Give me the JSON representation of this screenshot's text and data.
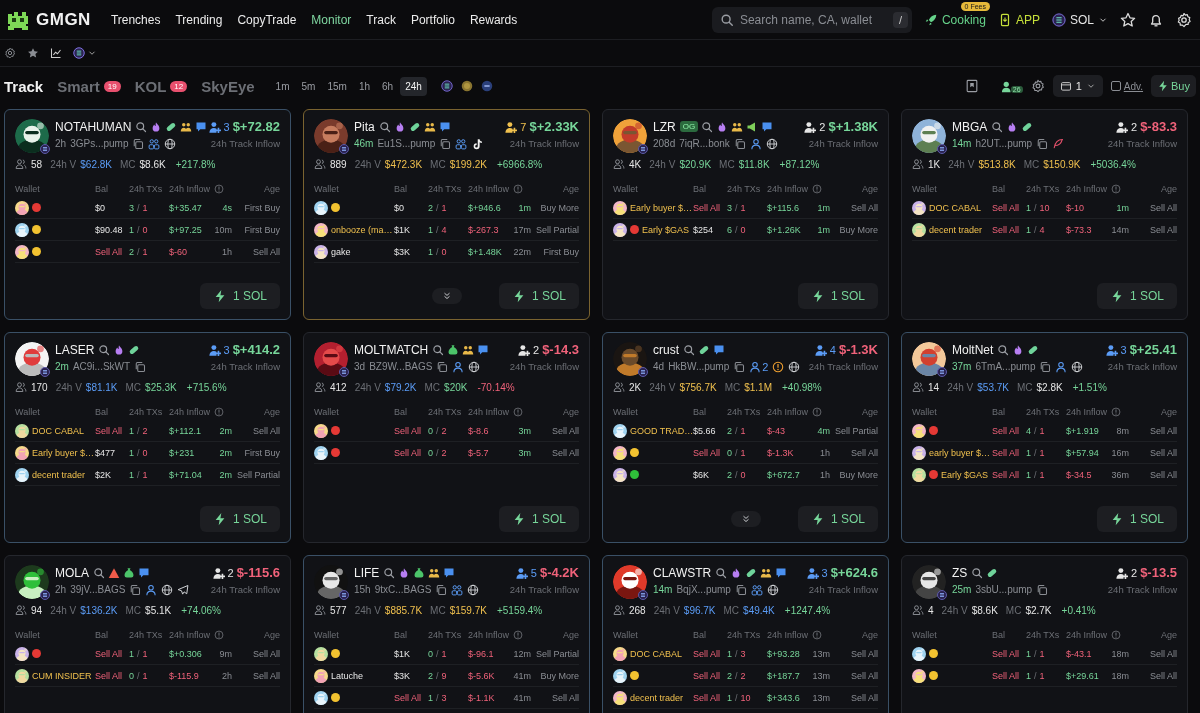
{
  "nav": {
    "logo": "GMGN",
    "items": [
      {
        "label": "Trenches",
        "selected": false
      },
      {
        "label": "Trending",
        "selected": false
      },
      {
        "label": "CopyTrade",
        "selected": false
      },
      {
        "label": "Monitor",
        "selected": true
      },
      {
        "label": "Track",
        "selected": false
      },
      {
        "label": "Portfolio",
        "selected": false
      },
      {
        "label": "Rewards",
        "selected": false
      }
    ],
    "search": {
      "placeholder": "Search name, CA, wallet",
      "shortcut": "/"
    },
    "cooking": {
      "label": "Cooking",
      "badge": "0 Fees"
    },
    "app": "APP",
    "chain": "SOL"
  },
  "tabs": [
    {
      "label": "Track",
      "selected": true
    },
    {
      "label": "Smart",
      "count": "19",
      "selected": false
    },
    {
      "label": "KOL",
      "count": "12",
      "selected": false
    },
    {
      "label": "SkyEye",
      "selected": false
    }
  ],
  "periods": [
    {
      "label": "1m",
      "selected": false
    },
    {
      "label": "5m",
      "selected": false
    },
    {
      "label": "15m",
      "selected": false
    },
    {
      "label": "1h",
      "selected": false
    },
    {
      "label": "6h",
      "selected": false
    },
    {
      "label": "24h",
      "selected": true
    }
  ],
  "toolbar": {
    "count": "26",
    "quantity": "1",
    "adv": {
      "label": "Adv.",
      "checked": false
    },
    "buy": "Buy"
  },
  "cards": [
    {
      "name": "NOTAHUMAN",
      "age": "2h",
      "age_recent": false,
      "address": "3GPs...pump",
      "badges": [
        {
          "kind": "search"
        },
        {
          "kind": "fire"
        },
        {
          "kind": "pill"
        },
        {
          "kind": "group"
        },
        {
          "kind": "chat"
        }
      ],
      "links": [
        {
          "kind": "copy"
        },
        {
          "kind": "group"
        },
        {
          "kind": "web"
        }
      ],
      "tracker": {
        "count": "3",
        "color": "#5b9cf6"
      },
      "inflow": "$+72.82",
      "inflow_up": true,
      "inflow_label": "24h Track Inflow",
      "holders": "58",
      "volume_label": "24h V",
      "volume": {
        "value": "$62.8K",
        "kind": "blue"
      },
      "mc_label": "MC",
      "mc": {
        "value": "$8.6K",
        "kind": "plain"
      },
      "change": "+217.8%",
      "change_up": true,
      "border": {
        "color": "#3a5066"
      },
      "expandable": false,
      "columns": [
        "Wallet",
        "Bal",
        "24h TXs",
        "24h Inflow",
        "Age"
      ],
      "buy": "1 SOL",
      "rows": [
        {
          "color": "#e53935",
          "bal": "$0",
          "sell_all": false,
          "buys": "3",
          "sep": "/",
          "sells": "1",
          "inflow": "$+35.47",
          "inflow_up": true,
          "age": "4s",
          "age_recent": true,
          "action": "First Buy"
        },
        {
          "color": "#f2c230",
          "bal": "$90.48",
          "sell_all": false,
          "buys": "1",
          "sep": "/",
          "sells": "0",
          "inflow": "$+97.25",
          "inflow_up": true,
          "age": "10m",
          "age_recent": false,
          "action": "First Buy"
        },
        {
          "color": "#f2c230",
          "bal": "Sell All",
          "sell_all": true,
          "buys": "2",
          "sep": "/",
          "sells": "1",
          "inflow": "$-60",
          "inflow_up": false,
          "age": "1h",
          "age_recent": false,
          "action": "Sell All"
        }
      ]
    },
    {
      "name": "Pita",
      "age": "46m",
      "age_recent": true,
      "address": "Eu1S...pump",
      "badges": [
        {
          "kind": "search"
        },
        {
          "kind": "fire"
        },
        {
          "kind": "pill"
        },
        {
          "kind": "group"
        },
        {
          "kind": "chat"
        }
      ],
      "links": [
        {
          "kind": "copy"
        },
        {
          "kind": "group"
        },
        {
          "kind": "tiktok"
        }
      ],
      "tracker": {
        "count": "7",
        "color": "#f0c04e"
      },
      "inflow": "$+2.33K",
      "inflow_up": true,
      "inflow_label": "24h Track Inflow",
      "holders": "889",
      "volume_label": "24h V",
      "volume": {
        "value": "$472.3K",
        "kind": "gold"
      },
      "mc_label": "MC",
      "mc": {
        "value": "$199.2K",
        "kind": "gold"
      },
      "change": "+6966.8%",
      "change_up": true,
      "border": {
        "color": "#7a6330"
      },
      "expandable": true,
      "columns": [
        "Wallet",
        "Bal",
        "24h TXs",
        "24h Inflow",
        "Age"
      ],
      "buy": "1 SOL",
      "rows": [
        {
          "color": "#f2c230",
          "bal": "$0",
          "sell_all": false,
          "buys": "2",
          "sep": "/",
          "sells": "1",
          "inflow": "$+946.6",
          "inflow_up": true,
          "age": "1m",
          "age_recent": true,
          "action": "Buy More"
        },
        {
          "wallet": "onbooze (ma…",
          "wallet_highlight": true,
          "bal": "$1K",
          "sell_all": false,
          "buys": "1",
          "sep": "/",
          "sells": "4",
          "inflow": "$-267.3",
          "inflow_up": false,
          "age": "17m",
          "age_recent": false,
          "action": "Sell Partial"
        },
        {
          "wallet": "gake",
          "wallet_highlight": false,
          "bal": "$3K",
          "sell_all": false,
          "buys": "1",
          "sep": "/",
          "sells": "0",
          "inflow": "$+1.48K",
          "inflow_up": true,
          "age": "22m",
          "age_recent": false,
          "action": "First Buy"
        }
      ]
    },
    {
      "name": "LZR",
      "tag": "OG",
      "age": "208d",
      "age_recent": false,
      "address": "7iqR...bonk",
      "badges": [
        {
          "kind": "search"
        },
        {
          "kind": "fire"
        },
        {
          "kind": "group"
        },
        {
          "kind": "megaphone"
        },
        {
          "kind": "chat"
        }
      ],
      "links": [
        {
          "kind": "copy"
        },
        {
          "kind": "person"
        },
        {
          "kind": "web"
        }
      ],
      "tracker": {
        "count": "2",
        "color": "#e6e6e6"
      },
      "inflow": "$+1.38K",
      "inflow_up": true,
      "inflow_label": "24h Track Inflow",
      "holders": "4K",
      "volume_label": "24h V",
      "volume": {
        "value": "$20.9K",
        "kind": "green"
      },
      "mc_label": "MC",
      "mc": {
        "value": "$11.8K",
        "kind": "green"
      },
      "change": "+87.12%",
      "change_up": true,
      "border": {
        "color": "#25272d"
      },
      "expandable": false,
      "columns": [
        "Wallet",
        "Bal",
        "24h TXs",
        "24h Inflow",
        "Age"
      ],
      "buy": "1 SOL",
      "rows": [
        {
          "wallet": "Early buyer $…",
          "wallet_highlight": true,
          "bal": "Sell All",
          "sell_all": true,
          "buys": "3",
          "sep": "/",
          "sells": "1",
          "inflow": "$+115.6",
          "inflow_up": true,
          "age": "1m",
          "age_recent": true,
          "action": "Sell All"
        },
        {
          "color": "#e53935",
          "wallet": "Early $GAS",
          "wallet_highlight": true,
          "bal": "$254",
          "sell_all": false,
          "buys": "6",
          "sep": "/",
          "sells": "0",
          "inflow": "$+1.26K",
          "inflow_up": true,
          "age": "1m",
          "age_recent": true,
          "action": "Buy More"
        }
      ]
    },
    {
      "name": "MBGA",
      "age": "14m",
      "age_recent": true,
      "address": "h2UT...pump",
      "badges": [
        {
          "kind": "search"
        },
        {
          "kind": "fire"
        },
        {
          "kind": "pill"
        }
      ],
      "links": [
        {
          "kind": "copy"
        },
        {
          "kind": "feather"
        }
      ],
      "tracker": {
        "count": "2",
        "color": "#e6e6e6"
      },
      "inflow": "$-83.3",
      "inflow_up": false,
      "inflow_label": "24h Track Inflow",
      "holders": "1K",
      "volume_label": "24h V",
      "volume": {
        "value": "$513.8K",
        "kind": "gold"
      },
      "mc_label": "MC",
      "mc": {
        "value": "$150.9K",
        "kind": "gold"
      },
      "change": "+5036.4%",
      "change_up": true,
      "border": {
        "color": "#25272d"
      },
      "expandable": false,
      "columns": [
        "Wallet",
        "Bal",
        "24h TXs",
        "24h Inflow",
        "Age"
      ],
      "buy": "1 SOL",
      "rows": [
        {
          "wallet": "DOC CABAL",
          "wallet_highlight": true,
          "bal": "Sell All",
          "sell_all": true,
          "buys": "1",
          "sep": "/",
          "sells": "10",
          "inflow": "$-10",
          "inflow_up": false,
          "age": "1m",
          "age_recent": true,
          "action": "Sell All"
        },
        {
          "wallet": "decent trader",
          "wallet_highlight": true,
          "bal": "Sell All",
          "sell_all": true,
          "buys": "1",
          "sep": "/",
          "sells": "4",
          "inflow": "$-73.3",
          "inflow_up": false,
          "age": "14m",
          "age_recent": false,
          "action": "Sell All"
        }
      ]
    },
    {
      "name": "LASER",
      "age": "2m",
      "age_recent": true,
      "address": "AC9i...SkWT",
      "badges": [
        {
          "kind": "search"
        },
        {
          "kind": "fire"
        },
        {
          "kind": "pill"
        }
      ],
      "links": [
        {
          "kind": "copy"
        }
      ],
      "tracker": {
        "count": "3",
        "color": "#5b9cf6"
      },
      "inflow": "$+414.2",
      "inflow_up": true,
      "inflow_label": "24h Track Inflow",
      "holders": "170",
      "volume_label": "24h V",
      "volume": {
        "value": "$81.1K",
        "kind": "blue"
      },
      "mc_label": "MC",
      "mc": {
        "value": "$25.3K",
        "kind": "green"
      },
      "change": "+715.6%",
      "change_up": true,
      "border": {
        "color": "#3a5066"
      },
      "expandable": false,
      "columns": [
        "Wallet",
        "Bal",
        "24h TXs",
        "24h Inflow",
        "Age"
      ],
      "buy": "1 SOL",
      "rows": [
        {
          "wallet": "DOC CABAL",
          "wallet_highlight": true,
          "bal": "Sell All",
          "sell_all": true,
          "buys": "1",
          "sep": "/",
          "sells": "2",
          "inflow": "$+112.1",
          "inflow_up": true,
          "age": "2m",
          "age_recent": true,
          "action": "Sell All"
        },
        {
          "wallet": "Early buyer $…",
          "wallet_highlight": true,
          "bal": "$477",
          "sell_all": false,
          "buys": "1",
          "sep": "/",
          "sells": "0",
          "inflow": "$+231",
          "inflow_up": true,
          "age": "2m",
          "age_recent": true,
          "action": "First Buy"
        },
        {
          "wallet": "decent trader",
          "wallet_highlight": true,
          "bal": "$2K",
          "sell_all": false,
          "buys": "1",
          "sep": "/",
          "sells": "1",
          "inflow": "$+71.04",
          "inflow_up": true,
          "age": "2m",
          "age_recent": true,
          "action": "Sell Partial"
        }
      ]
    },
    {
      "name": "MOLTMATCH",
      "age": "3d",
      "age_recent": false,
      "address": "BZ9W...BAGS",
      "badges": [
        {
          "kind": "search"
        },
        {
          "kind": "moneybag"
        },
        {
          "kind": "group"
        },
        {
          "kind": "chat"
        }
      ],
      "links": [
        {
          "kind": "copy"
        },
        {
          "kind": "person"
        },
        {
          "kind": "web"
        }
      ],
      "tracker": {
        "count": "2",
        "color": "#e6e6e6"
      },
      "inflow": "$-14.3",
      "inflow_up": false,
      "inflow_label": "24h Track Inflow",
      "holders": "412",
      "volume_label": "24h V",
      "volume": {
        "value": "$79.2K",
        "kind": "blue"
      },
      "mc_label": "MC",
      "mc": {
        "value": "$20K",
        "kind": "green"
      },
      "change": "-70.14%",
      "change_up": false,
      "border": {
        "color": "#25272d"
      },
      "expandable": false,
      "columns": [
        "Wallet",
        "Bal",
        "24h TXs",
        "24h Inflow",
        "Age"
      ],
      "buy": "1 SOL",
      "rows": [
        {
          "color": "#e53935",
          "bal": "Sell All",
          "sell_all": true,
          "buys": "0",
          "sep": "/",
          "sells": "2",
          "inflow": "$-8.6",
          "inflow_up": false,
          "age": "3m",
          "age_recent": true,
          "action": "Sell All"
        },
        {
          "color": "#e53935",
          "bal": "Sell All",
          "sell_all": true,
          "buys": "0",
          "sep": "/",
          "sells": "2",
          "inflow": "$-5.7",
          "inflow_up": false,
          "age": "3m",
          "age_recent": true,
          "action": "Sell All"
        }
      ]
    },
    {
      "name": "crust",
      "age": "4d",
      "age_recent": false,
      "address": "HkBW...pump",
      "badges": [
        {
          "kind": "search"
        },
        {
          "kind": "pill"
        },
        {
          "kind": "chat"
        }
      ],
      "links": [
        {
          "kind": "copy"
        },
        {
          "kind": "person",
          "count": "2"
        },
        {
          "kind": "alert"
        },
        {
          "kind": "web"
        }
      ],
      "tracker": {
        "count": "4",
        "color": "#5b9cf6"
      },
      "inflow": "$-1.3K",
      "inflow_up": false,
      "inflow_label": "24h Track Inflow",
      "holders": "2K",
      "volume_label": "24h V",
      "volume": {
        "value": "$756.7K",
        "kind": "gold"
      },
      "mc_label": "MC",
      "mc": {
        "value": "$1.1M",
        "kind": "gold"
      },
      "change": "+40.98%",
      "change_up": true,
      "border": {
        "color": "#3a5066"
      },
      "expandable": true,
      "columns": [
        "Wallet",
        "Bal",
        "24h TXs",
        "24h Inflow",
        "Age"
      ],
      "buy": "1 SOL",
      "rows": [
        {
          "wallet": "GOOD TRAD…",
          "wallet_highlight": true,
          "bal": "$5.66",
          "sell_all": false,
          "buys": "2",
          "sep": "/",
          "sells": "1",
          "inflow": "$-43",
          "inflow_up": false,
          "age": "4m",
          "age_recent": true,
          "action": "Sell Partial"
        },
        {
          "color": "#f2c230",
          "bal": "Sell All",
          "sell_all": true,
          "buys": "0",
          "sep": "/",
          "sells": "1",
          "inflow": "$-1.3K",
          "inflow_up": false,
          "age": "1h",
          "age_recent": false,
          "action": "Sell All"
        },
        {
          "color": "#2fbf3a",
          "bal": "$6K",
          "sell_all": false,
          "buys": "2",
          "sep": "/",
          "sells": "0",
          "inflow": "$+672.7",
          "inflow_up": true,
          "age": "1h",
          "age_recent": false,
          "action": "Buy More"
        }
      ]
    },
    {
      "name": "MoltNet",
      "age": "37m",
      "age_recent": true,
      "address": "6TmA...pump",
      "badges": [
        {
          "kind": "search"
        },
        {
          "kind": "fire"
        },
        {
          "kind": "pill"
        }
      ],
      "links": [
        {
          "kind": "copy"
        },
        {
          "kind": "person"
        },
        {
          "kind": "web"
        }
      ],
      "tracker": {
        "count": "3",
        "color": "#5b9cf6"
      },
      "inflow": "$+25.41",
      "inflow_up": true,
      "inflow_label": "24h Track Inflow",
      "holders": "14",
      "volume_label": "24h V",
      "volume": {
        "value": "$53.7K",
        "kind": "blue"
      },
      "mc_label": "MC",
      "mc": {
        "value": "$2.8K",
        "kind": "plain"
      },
      "change": "+1.51%",
      "change_up": true,
      "border": {
        "color": "#3a5066"
      },
      "expandable": false,
      "columns": [
        "Wallet",
        "Bal",
        "24h TXs",
        "24h Inflow",
        "Age"
      ],
      "buy": "1 SOL",
      "rows": [
        {
          "color": "#e53935",
          "bal": "Sell All",
          "sell_all": true,
          "buys": "4",
          "sep": "/",
          "sells": "1",
          "inflow": "$+1.919",
          "inflow_up": true,
          "age": "8m",
          "age_recent": false,
          "action": "Sell All"
        },
        {
          "wallet": "early buyer $…",
          "wallet_highlight": true,
          "bal": "Sell All",
          "sell_all": true,
          "buys": "1",
          "sep": "/",
          "sells": "1",
          "inflow": "$+57.94",
          "inflow_up": true,
          "age": "16m",
          "age_recent": false,
          "action": "Sell All"
        },
        {
          "color": "#e53935",
          "wallet": "Early $GAS",
          "wallet_highlight": true,
          "bal": "Sell All",
          "sell_all": true,
          "buys": "1",
          "sep": "/",
          "sells": "1",
          "inflow": "$-34.5",
          "inflow_up": false,
          "age": "36m",
          "age_recent": false,
          "action": "Sell All"
        }
      ]
    },
    {
      "name": "MOLA",
      "age": "2h",
      "age_recent": false,
      "address": "39jV...BAGS",
      "badges": [
        {
          "kind": "search"
        },
        {
          "kind": "warning"
        },
        {
          "kind": "moneybag"
        },
        {
          "kind": "chat"
        }
      ],
      "links": [
        {
          "kind": "copy"
        },
        {
          "kind": "person"
        },
        {
          "kind": "web"
        },
        {
          "kind": "telegram"
        }
      ],
      "tracker": {
        "count": "2",
        "color": "#e6e6e6"
      },
      "inflow": "$-115.6",
      "inflow_up": false,
      "inflow_label": "24h Track Inflow",
      "holders": "94",
      "volume_label": "24h V",
      "volume": {
        "value": "$136.2K",
        "kind": "blue"
      },
      "mc_label": "MC",
      "mc": {
        "value": "$5.1K",
        "kind": "plain"
      },
      "change": "+74.06%",
      "change_up": true,
      "border": {
        "color": "#25272d"
      },
      "expandable": false,
      "columns": [
        "Wallet",
        "Bal",
        "24h TXs",
        "24h Inflow",
        "Age"
      ],
      "rows": [
        {
          "color": "#e53935",
          "bal": "Sell All",
          "sell_all": true,
          "buys": "1",
          "sep": "/",
          "sells": "1",
          "inflow": "$+0.306",
          "inflow_up": true,
          "age": "9m",
          "age_recent": false,
          "action": "Sell All"
        },
        {
          "wallet": "CUM INSIDER",
          "wallet_highlight": true,
          "bal": "Sell All",
          "sell_all": true,
          "buys": "0",
          "sep": "/",
          "sells": "1",
          "inflow": "$-115.9",
          "inflow_up": false,
          "age": "2h",
          "age_recent": false,
          "action": "Sell All"
        }
      ]
    },
    {
      "name": "LIFE",
      "age": "15h",
      "age_recent": false,
      "address": "9txC...BAGS",
      "badges": [
        {
          "kind": "search"
        },
        {
          "kind": "fire"
        },
        {
          "kind": "moneybag"
        },
        {
          "kind": "group"
        },
        {
          "kind": "chat"
        }
      ],
      "links": [
        {
          "kind": "copy"
        },
        {
          "kind": "group"
        },
        {
          "kind": "web"
        }
      ],
      "tracker": {
        "count": "5",
        "color": "#5b9cf6"
      },
      "inflow": "$-4.2K",
      "inflow_up": false,
      "inflow_label": "24h Track Inflow",
      "holders": "577",
      "volume_label": "24h V",
      "volume": {
        "value": "$885.7K",
        "kind": "gold"
      },
      "mc_label": "MC",
      "mc": {
        "value": "$159.7K",
        "kind": "gold"
      },
      "change": "+5159.4%",
      "change_up": true,
      "border": {
        "color": "#3a5066"
      },
      "expandable": false,
      "columns": [
        "Wallet",
        "Bal",
        "24h TXs",
        "24h Inflow",
        "Age"
      ],
      "rows": [
        {
          "color": "#f2c230",
          "bal": "$1K",
          "sell_all": false,
          "buys": "0",
          "sep": "/",
          "sells": "1",
          "inflow": "$-96.1",
          "inflow_up": false,
          "age": "12m",
          "age_recent": false,
          "action": "Sell Partial"
        },
        {
          "wallet": "Latuche",
          "wallet_highlight": false,
          "bal": "$3K",
          "sell_all": false,
          "buys": "2",
          "sep": "/",
          "sells": "9",
          "inflow": "$-5.6K",
          "inflow_up": false,
          "age": "41m",
          "age_recent": false,
          "action": "Buy More"
        },
        {
          "color": "#f2c230",
          "bal": "Sell All",
          "sell_all": true,
          "buys": "1",
          "sep": "/",
          "sells": "3",
          "inflow": "$-1.1K",
          "inflow_up": false,
          "age": "41m",
          "age_recent": false,
          "action": "Sell All"
        }
      ]
    },
    {
      "name": "CLAWSTR",
      "age": "14m",
      "age_recent": true,
      "address": "BqjX...pump",
      "badges": [
        {
          "kind": "search"
        },
        {
          "kind": "fire"
        },
        {
          "kind": "pill"
        },
        {
          "kind": "group"
        },
        {
          "kind": "chat"
        }
      ],
      "links": [
        {
          "kind": "copy"
        },
        {
          "kind": "group"
        },
        {
          "kind": "web"
        }
      ],
      "tracker": {
        "count": "3",
        "color": "#5b9cf6"
      },
      "inflow": "$+624.6",
      "inflow_up": true,
      "inflow_label": "24h Track Inflow",
      "holders": "268",
      "volume_label": "24h V",
      "volume": {
        "value": "$96.7K",
        "kind": "blue"
      },
      "mc_label": "MC",
      "mc": {
        "value": "$49.4K",
        "kind": "blue"
      },
      "change": "+1247.4%",
      "change_up": true,
      "border": {
        "color": "#3a5066"
      },
      "expandable": false,
      "columns": [
        "Wallet",
        "Bal",
        "24h TXs",
        "24h Inflow",
        "Age"
      ],
      "rows": [
        {
          "wallet": "DOC CABAL",
          "wallet_highlight": true,
          "bal": "Sell All",
          "sell_all": true,
          "buys": "1",
          "sep": "/",
          "sells": "3",
          "inflow": "$+93.28",
          "inflow_up": true,
          "age": "13m",
          "age_recent": false,
          "action": "Sell All"
        },
        {
          "color": "#f2c230",
          "bal": "Sell All",
          "sell_all": true,
          "buys": "2",
          "sep": "/",
          "sells": "2",
          "inflow": "$+187.7",
          "inflow_up": true,
          "age": "13m",
          "age_recent": false,
          "action": "Sell All"
        },
        {
          "wallet": "decent trader",
          "wallet_highlight": true,
          "bal": "Sell All",
          "sell_all": true,
          "buys": "1",
          "sep": "/",
          "sells": "10",
          "inflow": "$+343.6",
          "inflow_up": true,
          "age": "13m",
          "age_recent": false,
          "action": "Sell All"
        }
      ]
    },
    {
      "name": "ZS",
      "age": "25m",
      "age_recent": true,
      "address": "3sbU...pump",
      "badges": [
        {
          "kind": "search"
        },
        {
          "kind": "pill"
        }
      ],
      "links": [
        {
          "kind": "copy"
        }
      ],
      "tracker": {
        "count": "2",
        "color": "#e6e6e6"
      },
      "inflow": "$-13.5",
      "inflow_up": false,
      "inflow_label": "24h Track Inflow",
      "holders": "4",
      "volume_label": "24h V",
      "volume": {
        "value": "$8.6K",
        "kind": "plain"
      },
      "mc_label": "MC",
      "mc": {
        "value": "$2.7K",
        "kind": "plain"
      },
      "change": "+0.41%",
      "change_up": true,
      "border": {
        "color": "#25272d"
      },
      "expandable": false,
      "columns": [
        "Wallet",
        "Bal",
        "24h TXs",
        "24h Inflow",
        "Age"
      ],
      "rows": [
        {
          "color": "#f2c230",
          "bal": "Sell All",
          "sell_all": true,
          "buys": "1",
          "sep": "/",
          "sells": "1",
          "inflow": "$-43.1",
          "inflow_up": false,
          "age": "18m",
          "age_recent": false,
          "action": "Sell All"
        },
        {
          "color": "#f2c230",
          "bal": "Sell All",
          "sell_all": true,
          "buys": "1",
          "sep": "/",
          "sells": "1",
          "inflow": "$+29.61",
          "inflow_up": true,
          "age": "18m",
          "age_recent": false,
          "action": "Sell All"
        }
      ]
    }
  ]
}
